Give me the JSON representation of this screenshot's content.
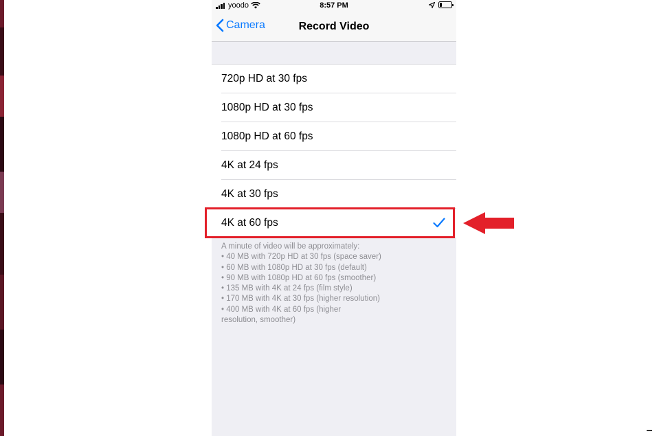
{
  "status_bar": {
    "carrier": "yoodo",
    "time": "8:57 PM"
  },
  "nav": {
    "back_label": "Camera",
    "title": "Record Video"
  },
  "options": [
    {
      "label": "720p HD at 30 fps",
      "selected": false
    },
    {
      "label": "1080p HD at 30 fps",
      "selected": false
    },
    {
      "label": "1080p HD at 60 fps",
      "selected": false
    },
    {
      "label": "4K at 24 fps",
      "selected": false
    },
    {
      "label": "4K at 30 fps",
      "selected": false
    },
    {
      "label": "4K at 60 fps",
      "selected": true
    }
  ],
  "footer": {
    "lines": [
      "A minute of video will be approximately:",
      "• 40 MB with 720p HD at 30 fps (space saver)",
      "• 60 MB with 1080p HD at 30 fps (default)",
      "• 90 MB with 1080p HD at 60 fps (smoother)",
      "• 135 MB with 4K at 24 fps (film style)",
      "• 170 MB with 4K at 30 fps (higher resolution)",
      "• 400 MB with 4K at 60 fps (higher",
      "resolution, smoother)"
    ]
  },
  "icons": {
    "signal": "signal-bars-icon",
    "wifi": "wifi-icon",
    "location": "location-arrow-icon",
    "battery": "battery-icon",
    "back": "chevron-left-icon",
    "check": "checkmark-icon",
    "annotation_arrow": "red-arrow-icon"
  },
  "colors": {
    "accent": "#0a7aff",
    "annotation": "#e3202a",
    "background": "#efeff4",
    "footer_text": "#8e8e93"
  }
}
